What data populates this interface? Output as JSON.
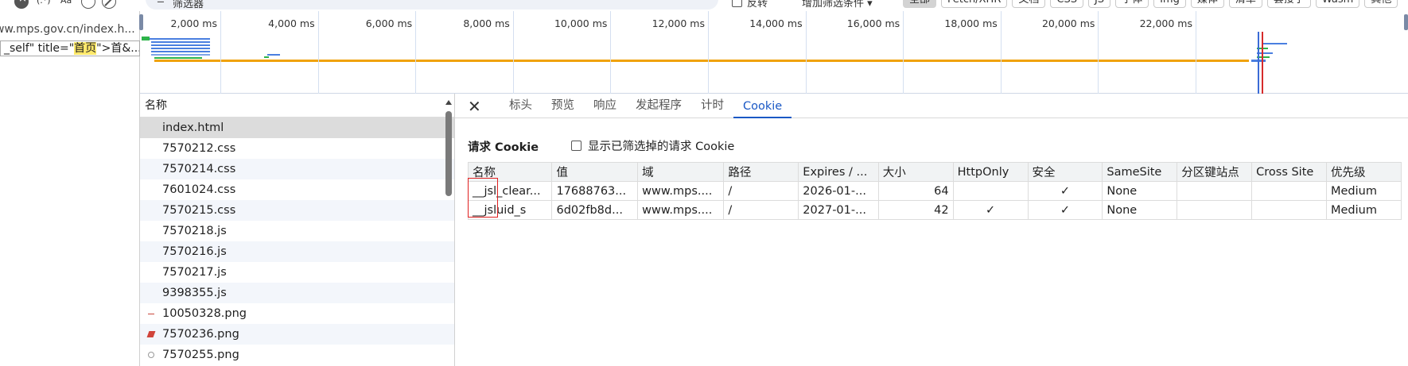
{
  "topbar": {
    "regex_label": "(.*)",
    "case_label": "Aa",
    "filter_placeholder": "筛选器",
    "invert_label": "反转",
    "more_filters_label": "增加筛选条件 ▾",
    "type_filters": [
      "全部",
      "Fetch/XHR",
      "文档",
      "CSS",
      "JS",
      "字体",
      "Img",
      "媒体",
      "清单",
      "套接字",
      "Wasm",
      "其他"
    ],
    "active_type": "全部"
  },
  "source_snippet": {
    "url": "ww.mps.gov.cn/index.h...",
    "code_before": "_self\" title=\"",
    "code_highlight": "首页",
    "code_after": "\">首&..."
  },
  "overview": {
    "ticks": [
      "2,000 ms",
      "4,000 ms",
      "6,000 ms",
      "8,000 ms",
      "10,000 ms",
      "12,000 ms",
      "14,000 ms",
      "16,000 ms",
      "18,000 ms",
      "20,000 ms",
      "22,000 ms"
    ]
  },
  "request_list": {
    "header": "名称",
    "rows": [
      {
        "name": "index.html",
        "icon": "doc-icon",
        "selected": true
      },
      {
        "name": "7570212.css",
        "icon": "css-icon"
      },
      {
        "name": "7570214.css",
        "icon": "css-icon"
      },
      {
        "name": "7601024.css",
        "icon": "css-icon"
      },
      {
        "name": "7570215.css",
        "icon": "css-icon"
      },
      {
        "name": "7570218.js",
        "icon": "js-icon"
      },
      {
        "name": "7570216.js",
        "icon": "js-icon"
      },
      {
        "name": "7570217.js",
        "icon": "js-icon"
      },
      {
        "name": "9398355.js",
        "icon": "js-icon"
      },
      {
        "name": "10050328.png",
        "icon": "image-icon"
      },
      {
        "name": "7570236.png",
        "icon": "image-icon"
      },
      {
        "name": "7570255.png",
        "icon": "image-icon"
      }
    ]
  },
  "details": {
    "tabs": [
      "标头",
      "预览",
      "响应",
      "发起程序",
      "计时",
      "Cookie"
    ],
    "active_tab": "Cookie",
    "section_title": "请求 Cookie",
    "show_filtered_label": "显示已筛选掉的请求 Cookie",
    "columns": [
      "名称",
      "值",
      "域",
      "路径",
      "Expires / ...",
      "大小",
      "HttpOnly",
      "安全",
      "SameSite",
      "分区键站点",
      "Cross Site",
      "优先级"
    ],
    "rows": [
      [
        "__jsl_clear...",
        "17688763...",
        "www.mps....",
        "/",
        "2026-01-...",
        "64",
        "",
        "✓",
        "None",
        "",
        "",
        "Medium"
      ],
      [
        "__jsluid_s",
        "6d02fb8d...",
        "www.mps....",
        "/",
        "2027-01-...",
        "42",
        "✓",
        "✓",
        "None",
        "",
        "",
        "Medium"
      ]
    ]
  },
  "colors": {
    "accent": "#1a58c5",
    "highlight_box": "#e02020",
    "timeline_orange": "#f0a20a"
  }
}
